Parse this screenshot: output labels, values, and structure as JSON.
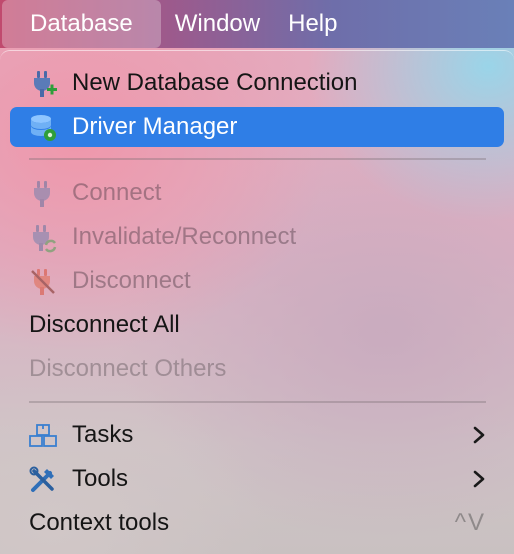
{
  "menubar": {
    "items": [
      {
        "label": "Database",
        "active": true
      },
      {
        "label": "Window"
      },
      {
        "label": "Help"
      }
    ]
  },
  "menu": {
    "items": {
      "new_connection": "New Database Connection",
      "driver_manager": "Driver Manager",
      "connect": "Connect",
      "invalidate": "Invalidate/Reconnect",
      "disconnect": "Disconnect",
      "disconnect_all": "Disconnect All",
      "disconnect_others": "Disconnect Others",
      "tasks": "Tasks",
      "tools": "Tools",
      "context_tools": "Context tools",
      "context_tools_shortcut": "^V"
    },
    "icons": {
      "new_connection": "plug-plus-icon",
      "driver_manager": "database-gear-icon",
      "connect": "plug-icon",
      "invalidate": "plug-refresh-icon",
      "disconnect": "plug-disconnect-icon",
      "tasks": "tasks-boxes-icon",
      "tools": "tools-icon"
    },
    "colors": {
      "selection": "#2f7ee6",
      "plug_blue": "#4a6aa8",
      "plus_green": "#2e9e3a",
      "disconnect_red": "#d9503a"
    }
  }
}
